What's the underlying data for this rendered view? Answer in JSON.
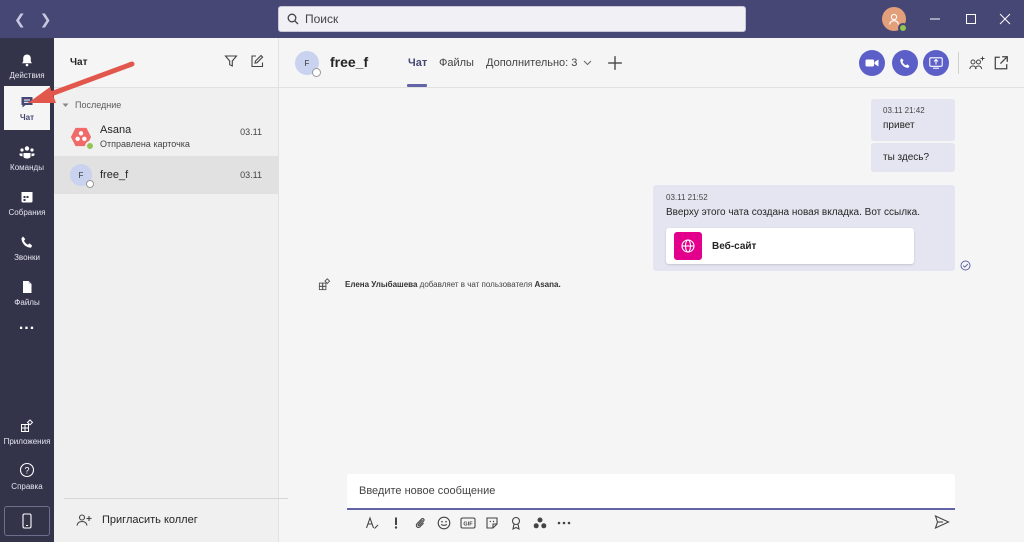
{
  "titlebar": {
    "search_placeholder": "Поиск"
  },
  "rail": {
    "items": [
      {
        "label": "Действия",
        "icon": "bell-icon"
      },
      {
        "label": "Чат",
        "icon": "chat-icon"
      },
      {
        "label": "Команды",
        "icon": "teams-icon"
      },
      {
        "label": "Собрания",
        "icon": "calendar-icon"
      },
      {
        "label": "Звонки",
        "icon": "phone-icon"
      },
      {
        "label": "Файлы",
        "icon": "file-icon"
      },
      {
        "label": "Приложения",
        "icon": "apps-icon"
      },
      {
        "label": "Справка",
        "icon": "help-icon"
      }
    ],
    "more": "..."
  },
  "chatlist": {
    "title": "Чат",
    "section": "Последние",
    "chats": [
      {
        "name": "Asana",
        "preview": "Отправлена карточка",
        "date": "03.11"
      },
      {
        "name": "free_f",
        "preview": "",
        "date": "03.11",
        "initial": "F"
      }
    ],
    "invite": "Пригласить коллег"
  },
  "conversation": {
    "initial": "F",
    "name": "free_f",
    "tabs": [
      "Чат",
      "Файлы",
      "Дополнительно: 3"
    ]
  },
  "messages": [
    {
      "time": "03.11 21:42",
      "text": "привет"
    },
    {
      "text": "ты здесь?"
    },
    {
      "time": "03.11 21:52",
      "text": "Вверху этого чата создана новая вкладка. Вот ссылка.",
      "card": "Веб-сайт"
    }
  ],
  "system_message": {
    "user": "Елена Улыбашева",
    "action": "добавляет в чат пользователя",
    "target": "Asana."
  },
  "compose": {
    "placeholder": "Введите новое сообщение"
  },
  "colors": {
    "titlebar": "#464775",
    "rail": "#33344a",
    "accent": "#6264a7",
    "call_button": "#5b5fc7",
    "card_icon": "#e3008c",
    "annotation": "#e2574c"
  }
}
